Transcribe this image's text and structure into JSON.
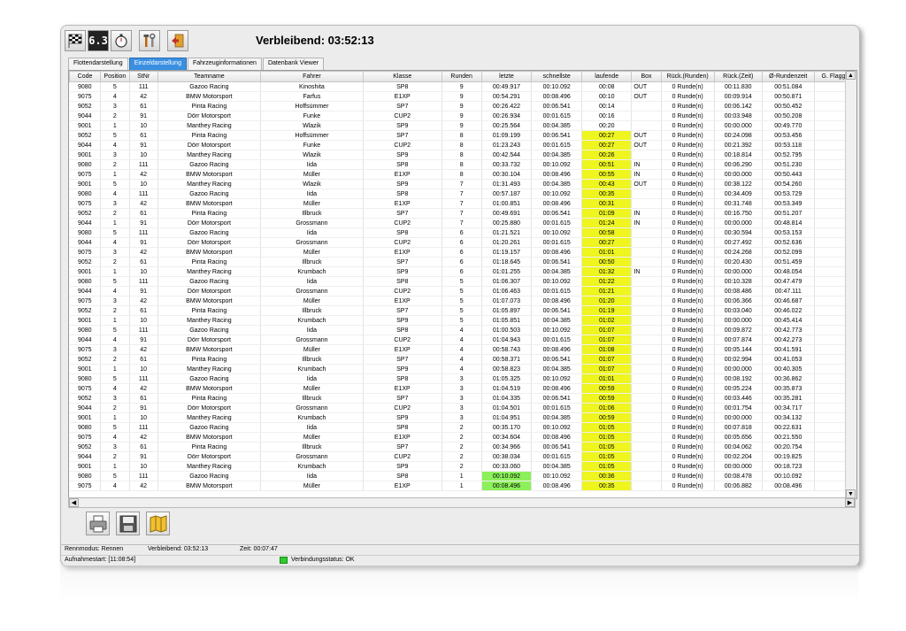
{
  "title": "Verbleibend: 03:52:13",
  "toolbar": {
    "icons": [
      "checkered-flag-icon",
      "display-63-icon",
      "stopwatch-icon",
      "tools-icon",
      "exit-door-icon"
    ],
    "display_text": "6.3"
  },
  "tabs": [
    {
      "label": "Flottendarstellung",
      "active": false
    },
    {
      "label": "Einzeldarstellung",
      "active": true
    },
    {
      "label": "Fahrzeuginformationen",
      "active": false
    },
    {
      "label": "Datenbank Viewer",
      "active": false
    }
  ],
  "columns": [
    "Code",
    "Position",
    "StNr",
    "Teamname",
    "Fahrer",
    "Klasse",
    "Runden",
    "letzte",
    "schnellste",
    "laufende",
    "Box",
    "Rück.(Runden)",
    "Rück.(Zeit)",
    "Ø-Rundenzeit",
    "G. Flagge"
  ],
  "rows": [
    [
      "9080",
      "5",
      "111",
      "Gazoo Racing",
      "Kinoshita",
      "SP8",
      "9",
      "00:49.917",
      "00:10.092",
      "00:08",
      "OUT",
      "0 Runde(n)",
      "00:11.830",
      "00:51.084",
      ""
    ],
    [
      "9075",
      "4",
      "42",
      "BMW Motorsport",
      "Farfus",
      "E1XP",
      "9",
      "00:54.291",
      "00:08.496",
      "00:10",
      "OUT",
      "0 Runde(n)",
      "00:09.914",
      "00:50.871",
      ""
    ],
    [
      "9052",
      "3",
      "61",
      "Pinta Racing",
      "Hoffsümmer",
      "SP7",
      "9",
      "00:26.422",
      "00:06.541",
      "00:14",
      "",
      "0 Runde(n)",
      "00:06.142",
      "00:50.452",
      ""
    ],
    [
      "9044",
      "2",
      "91",
      "Dörr Motorsport",
      "Funke",
      "CUP2",
      "9",
      "00:26.934",
      "00:01.615",
      "00:16",
      "",
      "0 Runde(n)",
      "00:03.948",
      "00:50.208",
      ""
    ],
    [
      "9001",
      "1",
      "10",
      "Manthey Racing",
      "Wlazik",
      "SP9",
      "9",
      "00:25.564",
      "00:04.385",
      "00:20",
      "",
      "0 Runde(n)",
      "00:00.000",
      "00:49.770",
      ""
    ],
    [
      "9052",
      "5",
      "61",
      "Pinta Racing",
      "Hoffsümmer",
      "SP7",
      "8",
      "01:09.199",
      "00:06.541",
      "00:27",
      "OUT",
      "0 Runde(n)",
      "00:24.098",
      "00:53.456",
      ""
    ],
    [
      "9044",
      "4",
      "91",
      "Dörr Motorsport",
      "Funke",
      "CUP2",
      "8",
      "01:23.243",
      "00:01.615",
      "00:27",
      "OUT",
      "0 Runde(n)",
      "00:21.392",
      "00:53.118",
      ""
    ],
    [
      "9001",
      "3",
      "10",
      "Manthey Racing",
      "Wlazik",
      "SP9",
      "8",
      "00:42.544",
      "00:04.385",
      "00:26",
      "",
      "0 Runde(n)",
      "00:18.814",
      "00:52.795",
      ""
    ],
    [
      "9080",
      "2",
      "111",
      "Gazoo Racing",
      "Iida",
      "SP8",
      "8",
      "00:33.732",
      "00:10.092",
      "00:51",
      "IN",
      "0 Runde(n)",
      "00:06.290",
      "00:51.230",
      ""
    ],
    [
      "9075",
      "1",
      "42",
      "BMW Motorsport",
      "Müller",
      "E1XP",
      "8",
      "00:30.104",
      "00:08.496",
      "00:55",
      "IN",
      "0 Runde(n)",
      "00:00.000",
      "00:50.443",
      ""
    ],
    [
      "9001",
      "5",
      "10",
      "Manthey Racing",
      "Wlazik",
      "SP9",
      "7",
      "01:31.493",
      "00:04.385",
      "00:43",
      "OUT",
      "0 Runde(n)",
      "00:38.122",
      "00:54.260",
      ""
    ],
    [
      "9080",
      "4",
      "111",
      "Gazoo Racing",
      "Iida",
      "SP8",
      "7",
      "00:57.187",
      "00:10.092",
      "00:35",
      "",
      "0 Runde(n)",
      "00:34.409",
      "00:53.729",
      ""
    ],
    [
      "9075",
      "3",
      "42",
      "BMW Motorsport",
      "Müller",
      "E1XP",
      "7",
      "01:00.851",
      "00:08.496",
      "00:31",
      "",
      "0 Runde(n)",
      "00:31.748",
      "00:53.349",
      ""
    ],
    [
      "9052",
      "2",
      "61",
      "Pinta Racing",
      "Illbruck",
      "SP7",
      "7",
      "00:49.691",
      "00:06.541",
      "01:09",
      "IN",
      "0 Runde(n)",
      "00:16.750",
      "00:51.207",
      ""
    ],
    [
      "9044",
      "1",
      "91",
      "Dörr Motorsport",
      "Grossmann",
      "CUP2",
      "7",
      "00:25.880",
      "00:01.615",
      "01:24",
      "IN",
      "0 Runde(n)",
      "00:00.000",
      "00:48.814",
      ""
    ],
    [
      "9080",
      "5",
      "111",
      "Gazoo Racing",
      "Iida",
      "SP8",
      "6",
      "01:21.521",
      "00:10.092",
      "00:58",
      "",
      "0 Runde(n)",
      "00:30.594",
      "00:53.153",
      ""
    ],
    [
      "9044",
      "4",
      "91",
      "Dörr Motorsport",
      "Grossmann",
      "CUP2",
      "6",
      "01:20.261",
      "00:01.615",
      "00:27",
      "",
      "0 Runde(n)",
      "00:27.492",
      "00:52.636",
      ""
    ],
    [
      "9075",
      "3",
      "42",
      "BMW Motorsport",
      "Müller",
      "E1XP",
      "6",
      "01:19.157",
      "00:08.496",
      "01:01",
      "",
      "0 Runde(n)",
      "00:24.268",
      "00:52.099",
      ""
    ],
    [
      "9052",
      "2",
      "61",
      "Pinta Racing",
      "Illbruck",
      "SP7",
      "6",
      "01:18.645",
      "00:06.541",
      "00:50",
      "",
      "0 Runde(n)",
      "00:20.430",
      "00:51.459",
      ""
    ],
    [
      "9001",
      "1",
      "10",
      "Manthey Racing",
      "Krumbach",
      "SP9",
      "6",
      "01:01.255",
      "00:04.385",
      "01:32",
      "IN",
      "0 Runde(n)",
      "00:00.000",
      "00:48.054",
      ""
    ],
    [
      "9080",
      "5",
      "111",
      "Gazoo Racing",
      "Iida",
      "SP8",
      "5",
      "01:06.307",
      "00:10.092",
      "01:22",
      "",
      "0 Runde(n)",
      "00:10.328",
      "00:47.479",
      ""
    ],
    [
      "9044",
      "4",
      "91",
      "Dörr Motorsport",
      "Grossmann",
      "CUP2",
      "5",
      "01:06.463",
      "00:01.615",
      "01:21",
      "",
      "0 Runde(n)",
      "00:08.486",
      "00:47.111",
      ""
    ],
    [
      "9075",
      "3",
      "42",
      "BMW Motorsport",
      "Müller",
      "E1XP",
      "5",
      "01:07.073",
      "00:08.496",
      "01:20",
      "",
      "0 Runde(n)",
      "00:06.366",
      "00:46.687",
      ""
    ],
    [
      "9052",
      "2",
      "61",
      "Pinta Racing",
      "Illbruck",
      "SP7",
      "5",
      "01:05.897",
      "00:06.541",
      "01:19",
      "",
      "0 Runde(n)",
      "00:03.040",
      "00:46.022",
      ""
    ],
    [
      "9001",
      "1",
      "10",
      "Manthey Racing",
      "Krumbach",
      "SP9",
      "5",
      "01:05.851",
      "00:04.385",
      "01:02",
      "",
      "0 Runde(n)",
      "00:00.000",
      "00:45.414",
      ""
    ],
    [
      "9080",
      "5",
      "111",
      "Gazoo Racing",
      "Iida",
      "SP8",
      "4",
      "01:00.503",
      "00:10.092",
      "01:07",
      "",
      "0 Runde(n)",
      "00:09.872",
      "00:42.773",
      ""
    ],
    [
      "9044",
      "4",
      "91",
      "Dörr Motorsport",
      "Grossmann",
      "CUP2",
      "4",
      "01:04.943",
      "00:01.615",
      "01:07",
      "",
      "0 Runde(n)",
      "00:07.874",
      "00:42.273",
      ""
    ],
    [
      "9075",
      "3",
      "42",
      "BMW Motorsport",
      "Müller",
      "E1XP",
      "4",
      "00:58.743",
      "00:08.496",
      "01:08",
      "",
      "0 Runde(n)",
      "00:05.144",
      "00:41.591",
      ""
    ],
    [
      "9052",
      "2",
      "61",
      "Pinta Racing",
      "Illbruck",
      "SP7",
      "4",
      "00:58.371",
      "00:06.541",
      "01:07",
      "",
      "0 Runde(n)",
      "00:02.994",
      "00:41.053",
      ""
    ],
    [
      "9001",
      "1",
      "10",
      "Manthey Racing",
      "Krumbach",
      "SP9",
      "4",
      "00:58.823",
      "00:04.385",
      "01:07",
      "",
      "0 Runde(n)",
      "00:00.000",
      "00:40.305",
      ""
    ],
    [
      "9080",
      "5",
      "111",
      "Gazoo Racing",
      "Iida",
      "SP8",
      "3",
      "01:05.325",
      "00:10.092",
      "01:01",
      "",
      "0 Runde(n)",
      "00:08.192",
      "00:36.862",
      ""
    ],
    [
      "9075",
      "4",
      "42",
      "BMW Motorsport",
      "Müller",
      "E1XP",
      "3",
      "01:04.519",
      "00:08.496",
      "00:59",
      "",
      "0 Runde(n)",
      "00:05.224",
      "00:35.873",
      ""
    ],
    [
      "9052",
      "3",
      "61",
      "Pinta Racing",
      "Illbruck",
      "SP7",
      "3",
      "01:04.335",
      "00:06.541",
      "00:59",
      "",
      "0 Runde(n)",
      "00:03.446",
      "00:35.281",
      ""
    ],
    [
      "9044",
      "2",
      "91",
      "Dörr Motorsport",
      "Grossmann",
      "CUP2",
      "3",
      "01:04.501",
      "00:01.615",
      "01:06",
      "",
      "0 Runde(n)",
      "00:01.754",
      "00:34.717",
      ""
    ],
    [
      "9001",
      "1",
      "10",
      "Manthey Racing",
      "Krumbach",
      "SP9",
      "3",
      "01:04.951",
      "00:04.385",
      "00:59",
      "",
      "0 Runde(n)",
      "00:00.000",
      "00:34.132",
      ""
    ],
    [
      "9080",
      "5",
      "111",
      "Gazoo Racing",
      "Iida",
      "SP8",
      "2",
      "00:35.170",
      "00:10.092",
      "01:05",
      "",
      "0 Runde(n)",
      "00:07.818",
      "00:22.631",
      ""
    ],
    [
      "9075",
      "4",
      "42",
      "BMW Motorsport",
      "Müller",
      "E1XP",
      "2",
      "00:34.604",
      "00:08.496",
      "01:05",
      "",
      "0 Runde(n)",
      "00:05.656",
      "00:21.550",
      ""
    ],
    [
      "9052",
      "3",
      "61",
      "Pinta Racing",
      "Illbruck",
      "SP7",
      "2",
      "00:34.966",
      "00:06.541",
      "01:05",
      "",
      "0 Runde(n)",
      "00:04.062",
      "00:20.754",
      ""
    ],
    [
      "9044",
      "2",
      "91",
      "Dörr Motorsport",
      "Grossmann",
      "CUP2",
      "2",
      "00:38.034",
      "00:01.615",
      "01:05",
      "",
      "0 Runde(n)",
      "00:02.204",
      "00:19.825",
      ""
    ],
    [
      "9001",
      "1",
      "10",
      "Manthey Racing",
      "Krumbach",
      "SP9",
      "2",
      "00:33.060",
      "00:04.385",
      "01:05",
      "",
      "0 Runde(n)",
      "00:00.000",
      "00:18.723",
      ""
    ],
    [
      "9080",
      "5",
      "111",
      "Gazoo Racing",
      "Iida",
      "SP8",
      "1",
      "00:10.092",
      "00:10.092",
      "00:36",
      "",
      "0 Runde(n)",
      "00:08.478",
      "00:10.092",
      ""
    ],
    [
      "9075",
      "4",
      "42",
      "BMW Motorsport",
      "Müller",
      "E1XP",
      "1",
      "00:08.496",
      "00:08.496",
      "00:35",
      "",
      "0 Runde(n)",
      "00:06.882",
      "00:08.496",
      ""
    ]
  ],
  "highlight_column": "laufende",
  "highlight_from_row": 5,
  "green_cells": [
    [
      40,
      7
    ],
    [
      41,
      7
    ]
  ],
  "colors": {
    "highlight": "#eef51f",
    "green": "#8cf05a",
    "tab_active": "#3a8fe0",
    "led": "#2ecc2e"
  },
  "bottom_buttons": [
    "printer-icon",
    "save-disk-icon",
    "map-icon"
  ],
  "status": {
    "mode": "Rennmodus: Rennen",
    "remaining": "Verbleibend: 03:52:13",
    "time": "Zeit: 00:07:47",
    "start": "Aufnahmestart: [11:08:54]",
    "connection": "Verbindungsstatus: OK"
  }
}
